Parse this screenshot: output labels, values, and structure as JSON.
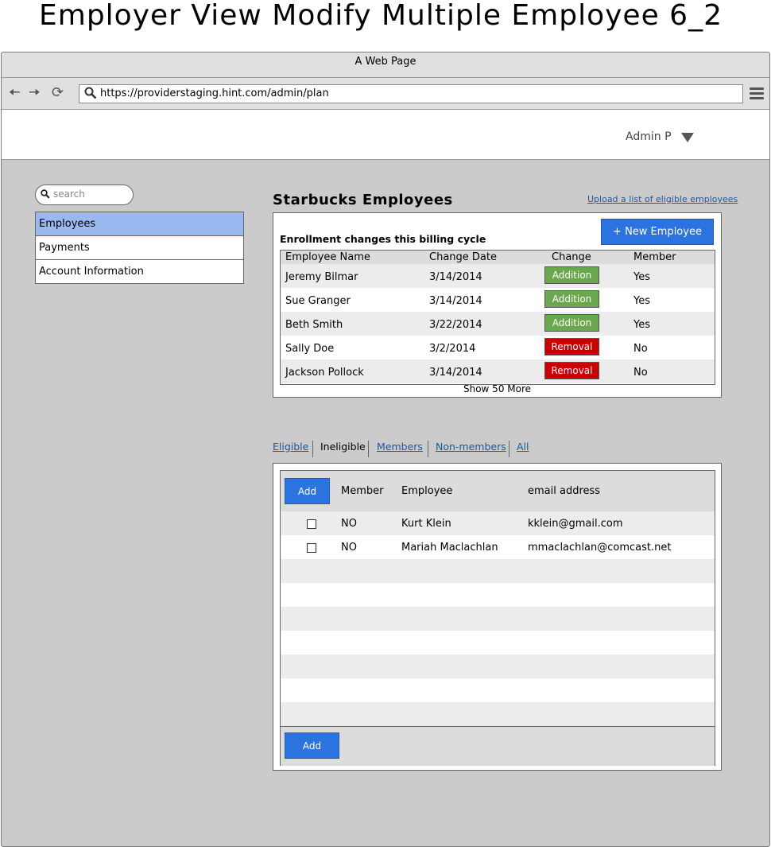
{
  "page_title": "Employer View Modify Multiple Employee 6_2",
  "browser": {
    "window_title": "A Web Page",
    "url": "https://providerstaging.hint.com/admin/plan"
  },
  "header": {
    "user_name": "Admin P"
  },
  "search": {
    "placeholder": "search"
  },
  "sidebar": {
    "items": [
      {
        "label": "Employees",
        "active": true
      },
      {
        "label": "Payments"
      },
      {
        "label": "Account Information"
      }
    ]
  },
  "main": {
    "title": "Starbucks Employees",
    "upload_link": "Upload a list of eligible employees",
    "new_employee_label": "+ New Employee",
    "enrollment_label": "Enrollment changes this billing cycle",
    "enrollment_columns": [
      "Employee Name",
      "Change Date",
      "Change",
      "Member"
    ],
    "enrollment_rows": [
      {
        "name": "Jeremy Bilmar",
        "date": "3/14/2014",
        "change": "Addition",
        "member": "Yes"
      },
      {
        "name": "Sue Granger",
        "date": "3/14/2014",
        "change": "Addition",
        "member": "Yes"
      },
      {
        "name": "Beth Smith",
        "date": "3/22/2014",
        "change": "Addition",
        "member": "Yes"
      },
      {
        "name": "Sally Doe",
        "date": "3/2/2014",
        "change": "Removal",
        "member": "No"
      },
      {
        "name": "Jackson Pollock",
        "date": "3/14/2014",
        "change": "Removal",
        "member": "No"
      }
    ],
    "show_more": "Show 50 More",
    "tabs": [
      "Eligible",
      "Ineligible",
      "Members",
      "Non-members",
      "All"
    ],
    "active_tab": "Ineligible",
    "employee_table": {
      "add_label": "Add",
      "columns": [
        "Member",
        "Employee",
        "email address"
      ],
      "rows": [
        {
          "member": "NO",
          "employee": "Kurt Klein",
          "email": "kklein@gmail.com"
        },
        {
          "member": "NO",
          "employee": "Mariah Maclachlan",
          "email": "mmaclachlan@comcast.net"
        }
      ],
      "footer_add_label": "Add"
    }
  },
  "colors": {
    "accent_blue": "#2b74e0",
    "addition_green": "#6aa84f",
    "removal_red": "#cc0000",
    "sidebar_active": "#99b9f0",
    "link": "#1f56a0"
  }
}
